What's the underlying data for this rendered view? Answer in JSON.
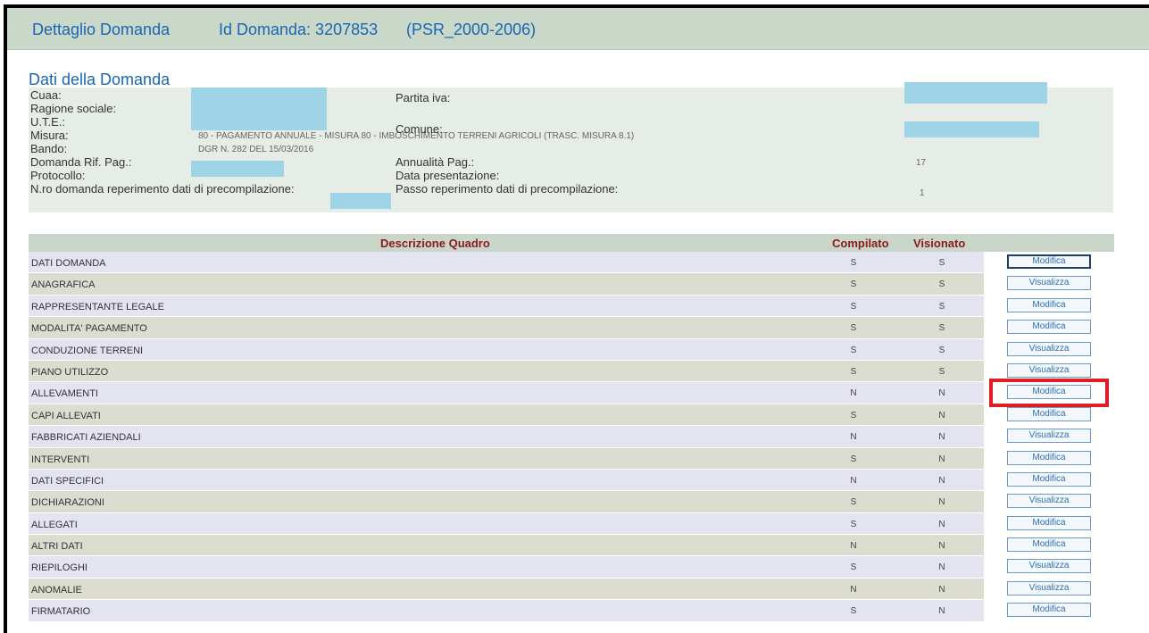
{
  "header": {
    "title": "Dettaglio Domanda",
    "id_label": "Id Domanda: 3207853",
    "program": "(PSR_2000-2006)"
  },
  "section_title": "Dati della Domanda",
  "info": {
    "cuaa_label": "Cuaa:",
    "ragione_label": "Ragione sociale:",
    "ute_label": "U.T.E.:",
    "misura_label": "Misura:",
    "misura_value": "80 - PAGAMENTO ANNUALE - MISURA 80 - IMBOSCHIMENTO TERRENI AGRICOLI (TRASC. MISURA 8.1)",
    "bando_label": "Bando:",
    "bando_value": "DGR N. 282 DEL 15/03/2016",
    "domanda_rif_label": "Domanda Rif. Pag.:",
    "protocollo_label": "Protocollo:",
    "nro_domanda_label": "N.ro domanda reperimento dati di precompilazione:",
    "partita_iva_label": "Partita iva:",
    "comune_label": "Comune:",
    "annualita_label": "Annualità Pag.:",
    "annualita_value": "17",
    "data_presentazione_label": "Data presentazione:",
    "passo_label": "Passo reperimento dati di precompilazione:",
    "passo_value": "1"
  },
  "table": {
    "headers": {
      "descrizione": "Descrizione Quadro",
      "compilato": "Compilato",
      "visionato": "Visionato"
    },
    "rows": [
      {
        "name": "DATI DOMANDA",
        "compilato": "S",
        "visionato": "S",
        "action": "Modifica"
      },
      {
        "name": "ANAGRAFICA",
        "compilato": "S",
        "visionato": "S",
        "action": "Visualizza"
      },
      {
        "name": "RAPPRESENTANTE LEGALE",
        "compilato": "S",
        "visionato": "S",
        "action": "Modifica"
      },
      {
        "name": "MODALITA' PAGAMENTO",
        "compilato": "S",
        "visionato": "S",
        "action": "Modifica"
      },
      {
        "name": "CONDUZIONE TERRENI",
        "compilato": "S",
        "visionato": "S",
        "action": "Visualizza"
      },
      {
        "name": "PIANO UTILIZZO",
        "compilato": "S",
        "visionato": "S",
        "action": "Visualizza"
      },
      {
        "name": "ALLEVAMENTI",
        "compilato": "N",
        "visionato": "N",
        "action": "Modifica"
      },
      {
        "name": "CAPI ALLEVATI",
        "compilato": "S",
        "visionato": "N",
        "action": "Modifica"
      },
      {
        "name": "FABBRICATI AZIENDALI",
        "compilato": "N",
        "visionato": "N",
        "action": "Visualizza"
      },
      {
        "name": "INTERVENTI",
        "compilato": "S",
        "visionato": "N",
        "action": "Modifica"
      },
      {
        "name": "DATI SPECIFICI",
        "compilato": "N",
        "visionato": "N",
        "action": "Modifica"
      },
      {
        "name": "DICHIARAZIONI",
        "compilato": "S",
        "visionato": "N",
        "action": "Visualizza"
      },
      {
        "name": "ALLEGATI",
        "compilato": "S",
        "visionato": "N",
        "action": "Modifica"
      },
      {
        "name": "ALTRI DATI",
        "compilato": "N",
        "visionato": "N",
        "action": "Modifica"
      },
      {
        "name": "RIEPILOGHI",
        "compilato": "S",
        "visionato": "N",
        "action": "Visualizza"
      },
      {
        "name": "ANOMALIE",
        "compilato": "N",
        "visionato": "N",
        "action": "Visualizza"
      },
      {
        "name": "FIRMATARIO",
        "compilato": "S",
        "visionato": "N",
        "action": "Modifica"
      }
    ]
  },
  "colors": {
    "header_bg": "#c9d8c9",
    "title_blue": "#1a66b3",
    "table_header_text": "#8b1a1a",
    "highlight_red": "#e01b24",
    "redaction_mask": "#9fd4e6"
  }
}
